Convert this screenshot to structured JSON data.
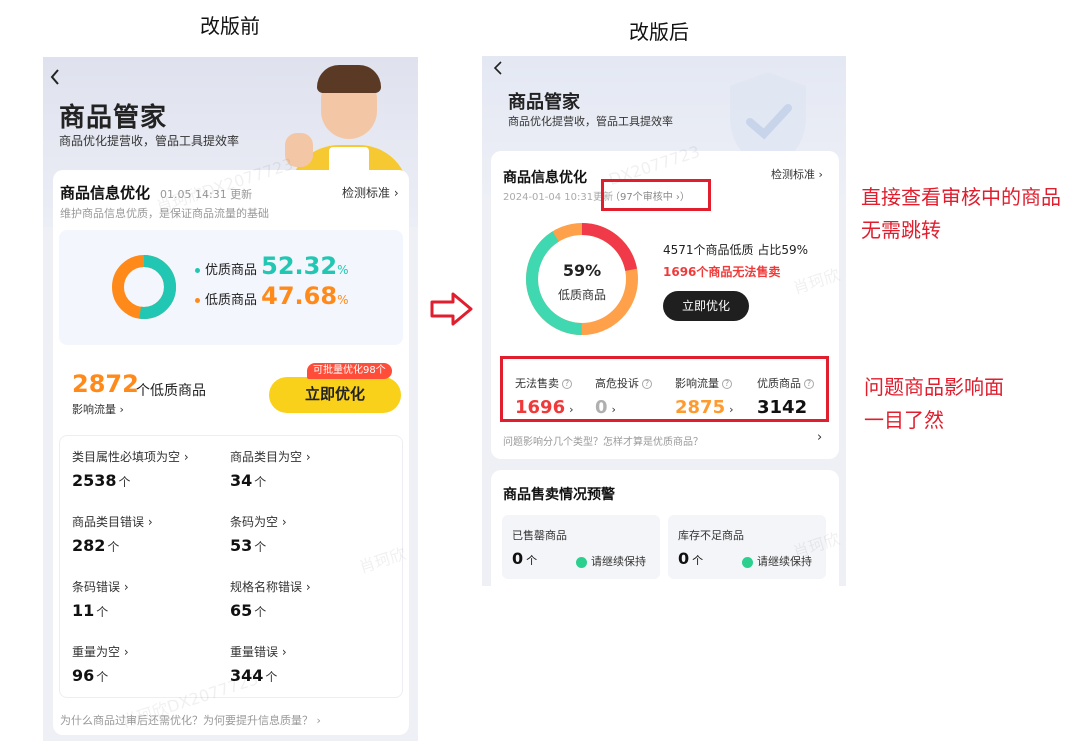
{
  "captions": {
    "before": "改版前",
    "after": "改版后"
  },
  "before": {
    "back_icon": "chevron-left-icon",
    "title": "商品管家",
    "subtitle": "商品优化提营收，管品工具提效率",
    "section_title": "商品信息优化",
    "update_time": "01.05 14:31 更新",
    "standard_link": "检测标准 ›",
    "section_desc": "维护商品信息优质，是保证商品流量的基础",
    "quality": {
      "good_label": "优质商品",
      "good_value": "52.32",
      "bad_label": "低质商品",
      "bad_value": "47.68",
      "pct_sign": "%"
    },
    "low_count": "2872",
    "low_count_label": "个低质商品",
    "impact_link": "影响流量 ›",
    "badge": "可批量优化98个",
    "optimize_button": "立即优化",
    "issues": [
      {
        "label": "类目属性必填项为空 ›",
        "value": "2538",
        "unit": "个"
      },
      {
        "label": "商品类目为空 ›",
        "value": "34",
        "unit": "个"
      },
      {
        "label": "商品类目错误 ›",
        "value": "282",
        "unit": "个"
      },
      {
        "label": "条码为空 ›",
        "value": "53",
        "unit": "个"
      },
      {
        "label": "条码错误 ›",
        "value": "11",
        "unit": "个"
      },
      {
        "label": "规格名称错误 ›",
        "value": "65",
        "unit": "个"
      },
      {
        "label": "重量为空 ›",
        "value": "96",
        "unit": "个"
      },
      {
        "label": "重量错误 ›",
        "value": "344",
        "unit": "个"
      }
    ],
    "footer_question": "为什么商品过审后还需优化？为何要提升信息质量？ ›",
    "watermarks": [
      "肖珂欣DX2077723",
      "肖珂欣",
      "肖珂欣DX2077723"
    ]
  },
  "after": {
    "back_icon": "chevron-left-icon",
    "title": "商品管家",
    "subtitle": "商品优化提营收，管品工具提效率",
    "section_title": "商品信息优化",
    "update_time": "2024-01-04 10:31更新",
    "reviewing": "（97个审核中 ›）",
    "standard_link": "检测标准 ›",
    "donut_pct": "59%",
    "donut_label": "低质商品",
    "low_line": "4571个商品低质 占比59%",
    "unsellable_line": "1696个商品无法售卖",
    "optimize_button": "立即优化",
    "stats": [
      {
        "label": "无法售卖",
        "value": "1696",
        "arrow": "›",
        "color": "#f03a3a"
      },
      {
        "label": "高危投诉",
        "value": "0",
        "arrow": "›",
        "color": "#b0b0b0"
      },
      {
        "label": "影响流量",
        "value": "2875",
        "arrow": "›",
        "color": "#ff9a2e"
      },
      {
        "label": "优质商品",
        "value": "3142",
        "arrow": "",
        "color": "#111111"
      }
    ],
    "question_row": "问题影响分几个类型？怎样才算是优质商品？",
    "question_arrow": "›",
    "sales_title": "商品售卖情况预警",
    "sales_cards": [
      {
        "label": "已售罄商品",
        "value": "0",
        "unit": "个",
        "keep": "请继续保持"
      },
      {
        "label": "库存不足商品",
        "value": "0",
        "unit": "个",
        "keep": "请继续保持"
      }
    ],
    "watermarks": [
      "DX2077723",
      "肖珂欣",
      "肖珂欣"
    ]
  },
  "annotations": {
    "review_note": [
      "直接查看审核中的商品",
      "无需跳转"
    ],
    "impact_note": [
      "问题商品影响面",
      "一目了然"
    ]
  },
  "colors": {
    "teal": "#22c7b3",
    "orange": "#ff8a1a",
    "red": "#e01e2e",
    "yellow": "#f9d11a"
  }
}
